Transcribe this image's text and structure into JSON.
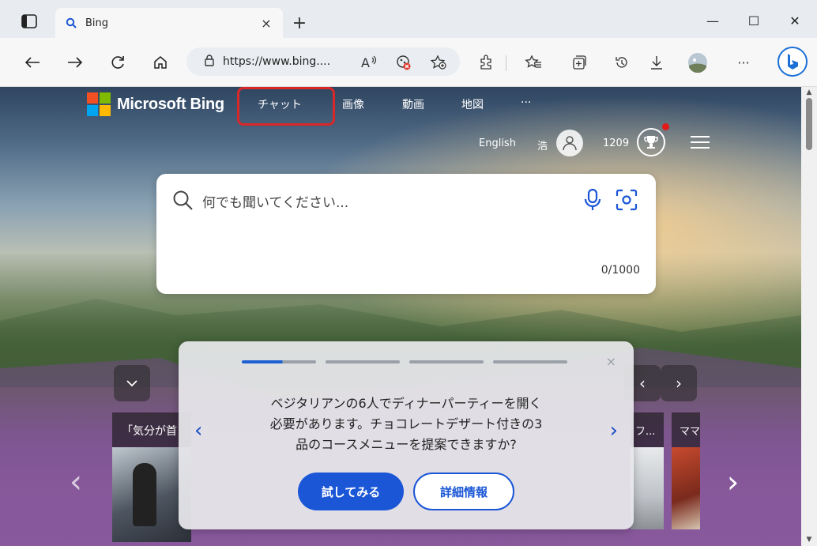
{
  "tab": {
    "title": "Bing",
    "close": "×"
  },
  "new_tab_label": "+",
  "window_controls": {
    "minimize": "—",
    "maximize": "☐",
    "close": "✕"
  },
  "address_bar": {
    "url": "https://www.bing....",
    "reader_label": "À"
  },
  "toolbar": {
    "more": "···"
  },
  "nav": {
    "brand": "Microsoft Bing",
    "chat": "チャット",
    "images": "画像",
    "videos": "動画",
    "maps": "地図",
    "more": "···"
  },
  "header_right": {
    "language": "English",
    "user_name": "浩",
    "points": "1209"
  },
  "search": {
    "placeholder": "何でも聞いてください...",
    "counter": "0/1000"
  },
  "promo": {
    "message_line1": "ベジタリアンの6人でディナーパーティーを開く",
    "message_line2": "必要があります。チョコレートデザート付きの3",
    "message_line3": "品のコースメニューを提案できますか?",
    "try_button": "試してみる",
    "more_button": "詳細情報",
    "close": "×",
    "prev": "‹",
    "next": "›"
  },
  "news": {
    "left_label": "「気分が首",
    "right_label_1": "フ...",
    "right_label_2": "ママ"
  },
  "colors": {
    "accent": "#1a56d6",
    "highlight_box": "#d8282a",
    "ms_red": "#f25022",
    "ms_green": "#7fba00",
    "ms_blue": "#00a4ef",
    "ms_yellow": "#ffb900"
  }
}
